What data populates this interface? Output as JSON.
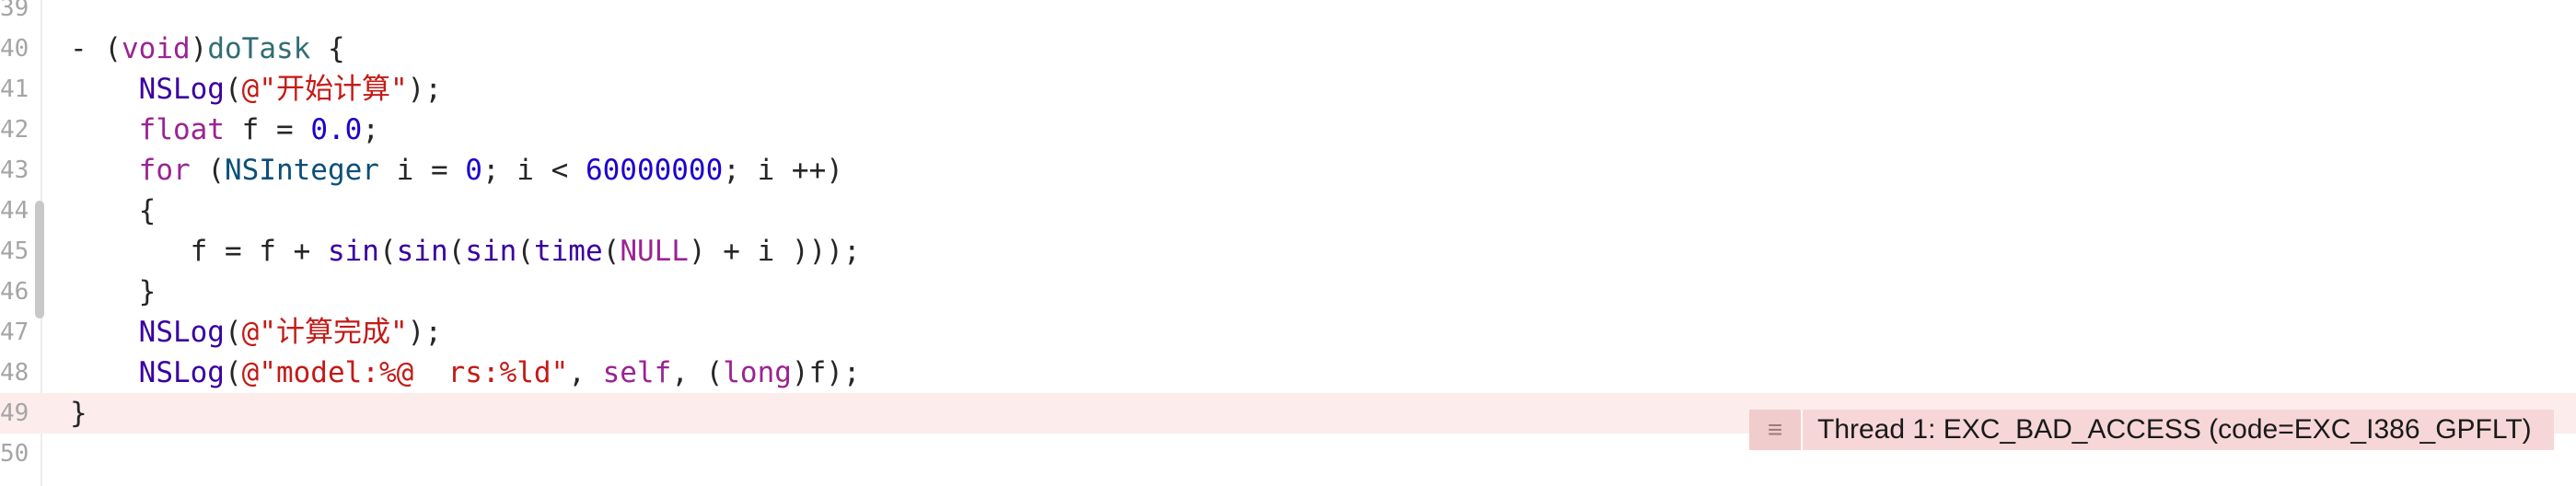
{
  "editor": {
    "lines": [
      {
        "num": "39",
        "tokens": []
      },
      {
        "num": "40",
        "tokens": [
          {
            "t": "- (",
            "c": "pu"
          },
          {
            "t": "void",
            "c": "kw"
          },
          {
            "t": ")",
            "c": "pu"
          },
          {
            "t": "doTask",
            "c": "fn"
          },
          {
            "t": " {",
            "c": "pu"
          }
        ]
      },
      {
        "num": "41",
        "tokens": [
          {
            "t": "    ",
            "c": "pu"
          },
          {
            "t": "NSLog",
            "c": "sy"
          },
          {
            "t": "(",
            "c": "pu"
          },
          {
            "t": "@\"开始计算\"",
            "c": "st"
          },
          {
            "t": ");",
            "c": "pu"
          }
        ]
      },
      {
        "num": "42",
        "tokens": [
          {
            "t": "    ",
            "c": "pu"
          },
          {
            "t": "float",
            "c": "kw"
          },
          {
            "t": " f = ",
            "c": "pu"
          },
          {
            "t": "0.0",
            "c": "nm"
          },
          {
            "t": ";",
            "c": "pu"
          }
        ]
      },
      {
        "num": "43",
        "tokens": [
          {
            "t": "    ",
            "c": "pu"
          },
          {
            "t": "for",
            "c": "kw"
          },
          {
            "t": " (",
            "c": "pu"
          },
          {
            "t": "NSInteger",
            "c": "ty"
          },
          {
            "t": " i = ",
            "c": "pu"
          },
          {
            "t": "0",
            "c": "nm"
          },
          {
            "t": "; i < ",
            "c": "pu"
          },
          {
            "t": "60000000",
            "c": "nm"
          },
          {
            "t": "; i ++)",
            "c": "pu"
          }
        ]
      },
      {
        "num": "44",
        "tokens": [
          {
            "t": "    {",
            "c": "pu"
          }
        ]
      },
      {
        "num": "45",
        "tokens": [
          {
            "t": "       f = f + ",
            "c": "pu"
          },
          {
            "t": "sin",
            "c": "sy"
          },
          {
            "t": "(",
            "c": "pu"
          },
          {
            "t": "sin",
            "c": "sy"
          },
          {
            "t": "(",
            "c": "pu"
          },
          {
            "t": "sin",
            "c": "sy"
          },
          {
            "t": "(",
            "c": "pu"
          },
          {
            "t": "time",
            "c": "sy"
          },
          {
            "t": "(",
            "c": "pu"
          },
          {
            "t": "NULL",
            "c": "kw"
          },
          {
            "t": ") + i )));",
            "c": "pu"
          }
        ]
      },
      {
        "num": "46",
        "tokens": [
          {
            "t": "    }",
            "c": "pu"
          }
        ]
      },
      {
        "num": "47",
        "tokens": [
          {
            "t": "    ",
            "c": "pu"
          },
          {
            "t": "NSLog",
            "c": "sy"
          },
          {
            "t": "(",
            "c": "pu"
          },
          {
            "t": "@\"计算完成\"",
            "c": "st"
          },
          {
            "t": ");",
            "c": "pu"
          }
        ]
      },
      {
        "num": "48",
        "tokens": [
          {
            "t": "    ",
            "c": "pu"
          },
          {
            "t": "NSLog",
            "c": "sy"
          },
          {
            "t": "(",
            "c": "pu"
          },
          {
            "t": "@\"model:%@  rs:%ld\"",
            "c": "st"
          },
          {
            "t": ", ",
            "c": "pu"
          },
          {
            "t": "self",
            "c": "kw"
          },
          {
            "t": ", (",
            "c": "pu"
          },
          {
            "t": "long",
            "c": "kw"
          },
          {
            "t": ")f);",
            "c": "pu"
          }
        ]
      },
      {
        "num": "49",
        "error": true,
        "tokens": [
          {
            "t": "}",
            "c": "pu"
          }
        ]
      },
      {
        "num": "50",
        "tokens": []
      }
    ]
  },
  "error_annotation": {
    "icon": "list-icon",
    "message": "Thread 1: EXC_BAD_ACCESS (code=EXC_I386_GPFLT)"
  }
}
